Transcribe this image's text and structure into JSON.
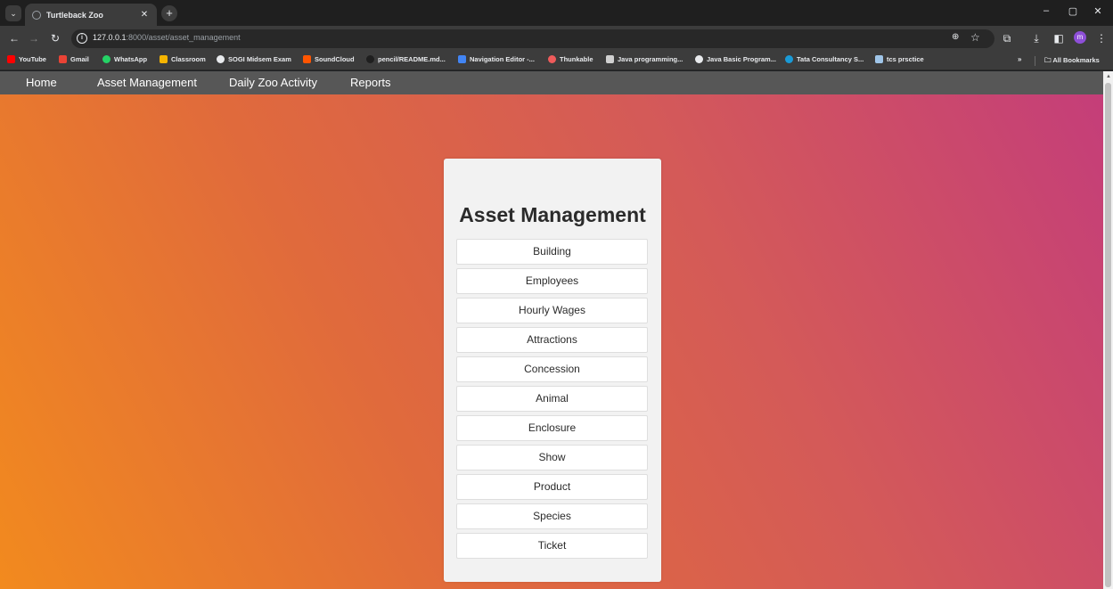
{
  "browser": {
    "tab_title": "Turtleback Zoo",
    "url_host": "127.0.0.1",
    "url_path": ":8000/asset/asset_management",
    "profile_initial": "m",
    "bookmarks": [
      "YouTube",
      "Gmail",
      "WhatsApp",
      "Classroom",
      "SOGI Midsem Exam",
      "SoundCloud",
      "pencil/README.md...",
      "Navigation Editor -...",
      "Thunkable",
      "Java programming...",
      "Java Basic Program...",
      "Tata Consultancy S...",
      "tcs prsctice"
    ],
    "bookmarks_more": "»",
    "all_bookmarks": "All Bookmarks"
  },
  "nav": {
    "items": [
      "Home",
      "Asset Management",
      "Daily Zoo Activity",
      "Reports"
    ]
  },
  "panel": {
    "title": "Asset Management",
    "buttons": [
      "Building",
      "Employees",
      "Hourly Wages",
      "Attractions",
      "Concession",
      "Animal",
      "Enclosure",
      "Show",
      "Product",
      "Species",
      "Ticket"
    ]
  }
}
